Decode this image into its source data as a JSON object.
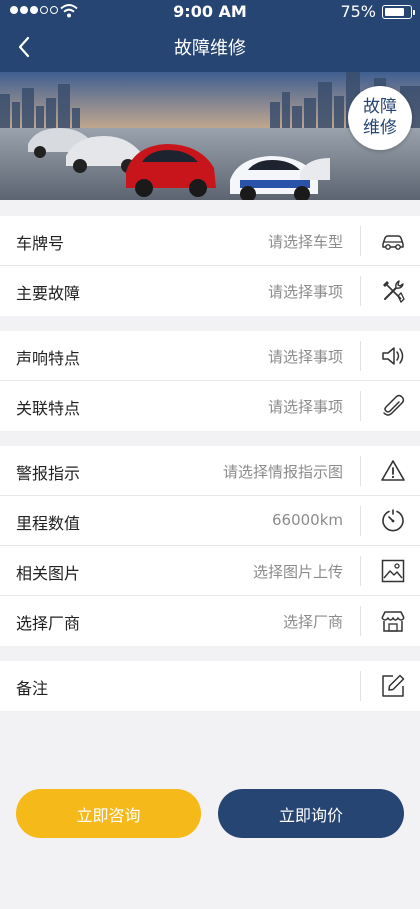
{
  "status_bar": {
    "time": "9:00 AM",
    "battery": "75%",
    "battery_level": 0.75
  },
  "header": {
    "title": "故障维修"
  },
  "banner": {
    "badge_line1": "故障",
    "badge_line2": "维修"
  },
  "sections": [
    [
      {
        "label": "车牌号",
        "value": "请选择车型",
        "icon": "car-icon"
      },
      {
        "label": "主要故障",
        "value": "请选择事项",
        "icon": "tools-icon"
      }
    ],
    [
      {
        "label": "声响特点",
        "value": "请选择事项",
        "icon": "speaker-icon"
      },
      {
        "label": "关联特点",
        "value": "请选择事项",
        "icon": "paperclip-icon"
      }
    ],
    [
      {
        "label": "警报指示",
        "value": "请选择情报指示图",
        "icon": "warning-icon"
      },
      {
        "label": "里程数值",
        "value": "66000km",
        "icon": "gauge-icon"
      },
      {
        "label": "相关图片",
        "value": "选择图片上传",
        "icon": "image-icon"
      },
      {
        "label": "选择厂商",
        "value": "选择厂商",
        "icon": "store-icon"
      }
    ],
    [
      {
        "label": "备注",
        "value": "",
        "icon": "edit-icon"
      }
    ]
  ],
  "actions": {
    "consult": "立即咨询",
    "quote": "立即询价"
  },
  "colors": {
    "primary": "#264573",
    "accent": "#f6b91a",
    "background": "#f2f2f4"
  }
}
